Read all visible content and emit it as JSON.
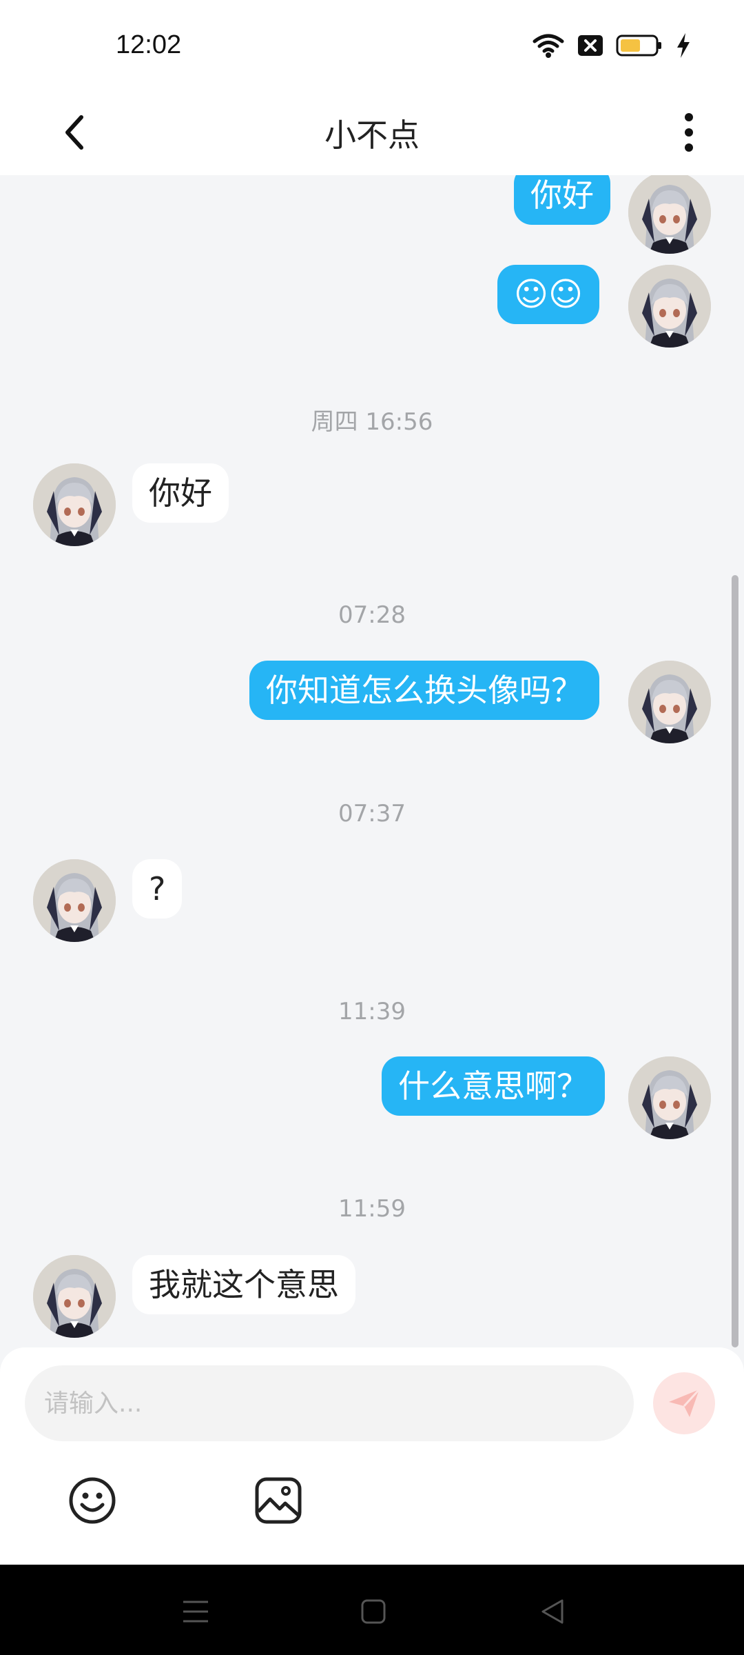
{
  "status_bar": {
    "time": "12:02"
  },
  "header": {
    "title": "小不点"
  },
  "timestamps": [
    "周四 16:56",
    "07:28",
    "07:37",
    "11:39",
    "11:59"
  ],
  "messages": [
    {
      "side": "out",
      "text": "你好"
    },
    {
      "side": "out",
      "text": "☺☺"
    },
    {
      "side": "in",
      "text": "你好"
    },
    {
      "side": "out",
      "text": "你知道怎么换头像吗？"
    },
    {
      "side": "in",
      "text": "?"
    },
    {
      "side": "out",
      "text": "什么意思啊？"
    },
    {
      "side": "in",
      "text": "我就这个意思"
    }
  ],
  "input": {
    "placeholder": "请输入..."
  },
  "icons": {
    "back": "chevron-left-icon",
    "more": "more-vertical-icon",
    "send": "send-icon",
    "emoji": "emoji-icon",
    "image": "image-icon"
  },
  "colors": {
    "outgoing_bubble": "#26b5f5",
    "incoming_bubble": "#ffffff",
    "background": "#f4f5f7",
    "send_button": "#fde4e2",
    "battery": "#f5c242"
  }
}
